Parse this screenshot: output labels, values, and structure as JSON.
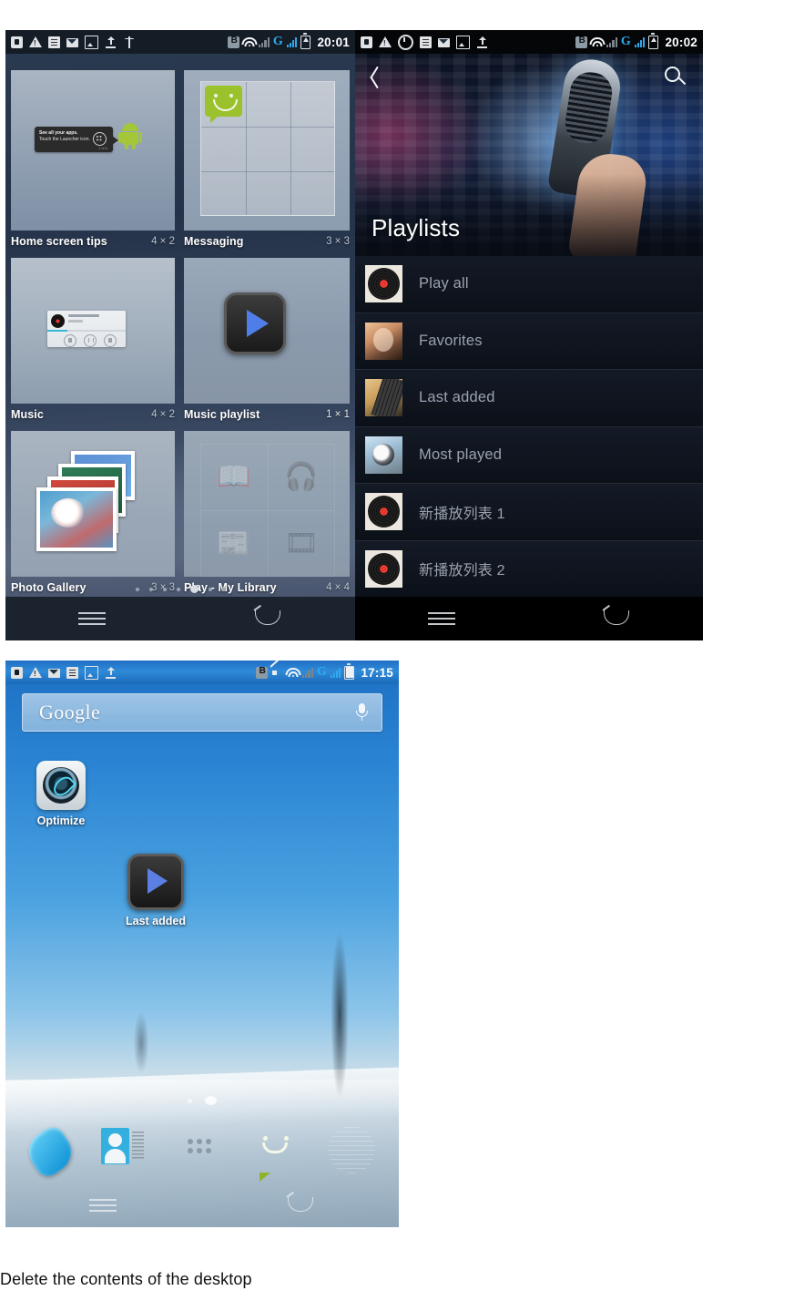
{
  "caption": "Delete the contents of the desktop",
  "phone_widget_picker": {
    "statusbar": {
      "time": "20:01",
      "left_icons": [
        "sim-icon",
        "warning-icon",
        "clipboard-icon",
        "mail-icon",
        "picture-icon",
        "upload-icon",
        "usb-icon"
      ],
      "right_icons": [
        "bluetooth-icon",
        "wifi-icon",
        "signal-bars-icon",
        "network-g-icon",
        "signal-bars-2-icon",
        "battery-charging-icon"
      ],
      "network_label": "G"
    },
    "widgets": [
      {
        "name": "Home screen tips",
        "size": "4 × 2",
        "thumb": "home-screen-tips-thumb",
        "tip": {
          "line1": "See all your apps.",
          "line2": "Touch the Launcher icon.",
          "counter": "1 of 6"
        }
      },
      {
        "name": "Messaging",
        "size": "3 × 3",
        "thumb": "messaging-grid-thumb"
      },
      {
        "name": "Music",
        "size": "4 × 2",
        "thumb": "music-player-widget-thumb"
      },
      {
        "name": "Music playlist",
        "size": "1 × 1",
        "thumb": "play-button-thumb"
      },
      {
        "name": "Photo Gallery",
        "size": "3 × 3",
        "thumb": "photo-stack-thumb"
      },
      {
        "name": "Play - My Library",
        "size": "4 × 4",
        "thumb": "play-library-thumb"
      }
    ],
    "page_dots": {
      "count": 8,
      "active_index": 4
    },
    "navbar": {
      "menu": "menu-icon",
      "back": "back-icon"
    }
  },
  "phone_playlists": {
    "statusbar": {
      "time": "20:02",
      "left_icons": [
        "sim-icon",
        "warning-icon",
        "alarm-icon",
        "clipboard-icon",
        "mail-icon",
        "picture-icon",
        "upload-icon"
      ],
      "right_icons": [
        "bluetooth-icon",
        "wifi-icon",
        "signal-bars-icon",
        "network-g-icon",
        "signal-bars-2-icon",
        "battery-charging-icon"
      ],
      "network_label": "G"
    },
    "header": {
      "back": "back-chevron-icon",
      "search": "search-icon",
      "title": "Playlists",
      "hero": "microphone-equalizer-image"
    },
    "items": [
      {
        "label": "Play all",
        "art": "vinyl-record-art"
      },
      {
        "label": "Favorites",
        "art": "woman-headphones-art"
      },
      {
        "label": "Last added",
        "art": "guitar-art"
      },
      {
        "label": "Most played",
        "art": "headphones-art"
      },
      {
        "label": "新播放列表 1",
        "art": "vinyl-record-art"
      },
      {
        "label": "新播放列表 2",
        "art": "vinyl-record-art"
      }
    ],
    "navbar": {
      "menu": "menu-icon",
      "back": "back-icon"
    }
  },
  "phone_home": {
    "statusbar": {
      "time": "17:15",
      "left_icons": [
        "sim-icon",
        "warning-icon",
        "mail-icon",
        "clipboard-icon",
        "picture-icon",
        "upload-icon"
      ],
      "right_icons": [
        "bluetooth-icon",
        "mute-icon",
        "wifi-icon",
        "signal-bars-icon",
        "network-g-icon",
        "signal-bars-2-icon",
        "battery-full-icon"
      ],
      "network_label": "G"
    },
    "search": {
      "brand": "Google",
      "voice": "microphone-icon"
    },
    "icons": [
      {
        "label": "Optimize",
        "icon": "optimize-leaf-icon"
      },
      {
        "label": "Last added",
        "icon": "music-play-icon"
      }
    ],
    "page_dots": {
      "count": 2,
      "active_index": 1
    },
    "dock": [
      {
        "name": "phone-dock-icon"
      },
      {
        "name": "contacts-dock-icon"
      },
      {
        "name": "app-drawer-dock-icon"
      },
      {
        "name": "messaging-dock-icon"
      },
      {
        "name": "browser-dock-icon"
      }
    ],
    "navbar": {
      "menu": "menu-icon",
      "back": "back-icon"
    }
  }
}
